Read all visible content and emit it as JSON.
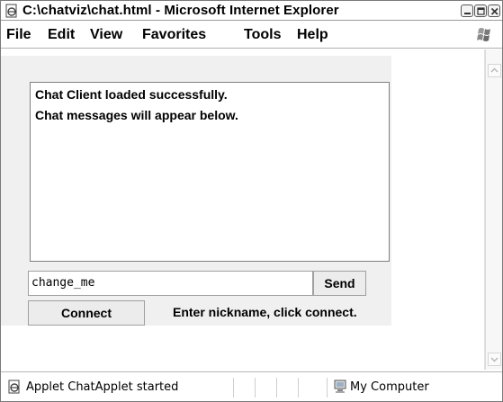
{
  "window": {
    "title": "C:\\chatviz\\chat.html - Microsoft Internet Explorer",
    "icon": "ie-page-icon",
    "controls": [
      "minimize-icon",
      "maximize-icon",
      "close-icon"
    ]
  },
  "menu": {
    "items": [
      "File",
      "Edit",
      "View",
      "Favorites",
      "Tools",
      "Help"
    ],
    "logo": "windows-flag-icon"
  },
  "applet": {
    "messages": [
      "Chat Client loaded successfully.",
      "Chat messages will appear below."
    ],
    "nickname_value": "change_me",
    "send_label": "Send",
    "connect_label": "Connect",
    "status_label": "Enter nickname, click connect."
  },
  "statusbar": {
    "text": "Applet ChatApplet started",
    "zone": "My Computer",
    "zone_icon": "my-computer-icon"
  },
  "colors": {
    "applet_bg": "#f0f0f0",
    "button_bg": "#ececec",
    "border": "#7f7f7f"
  }
}
